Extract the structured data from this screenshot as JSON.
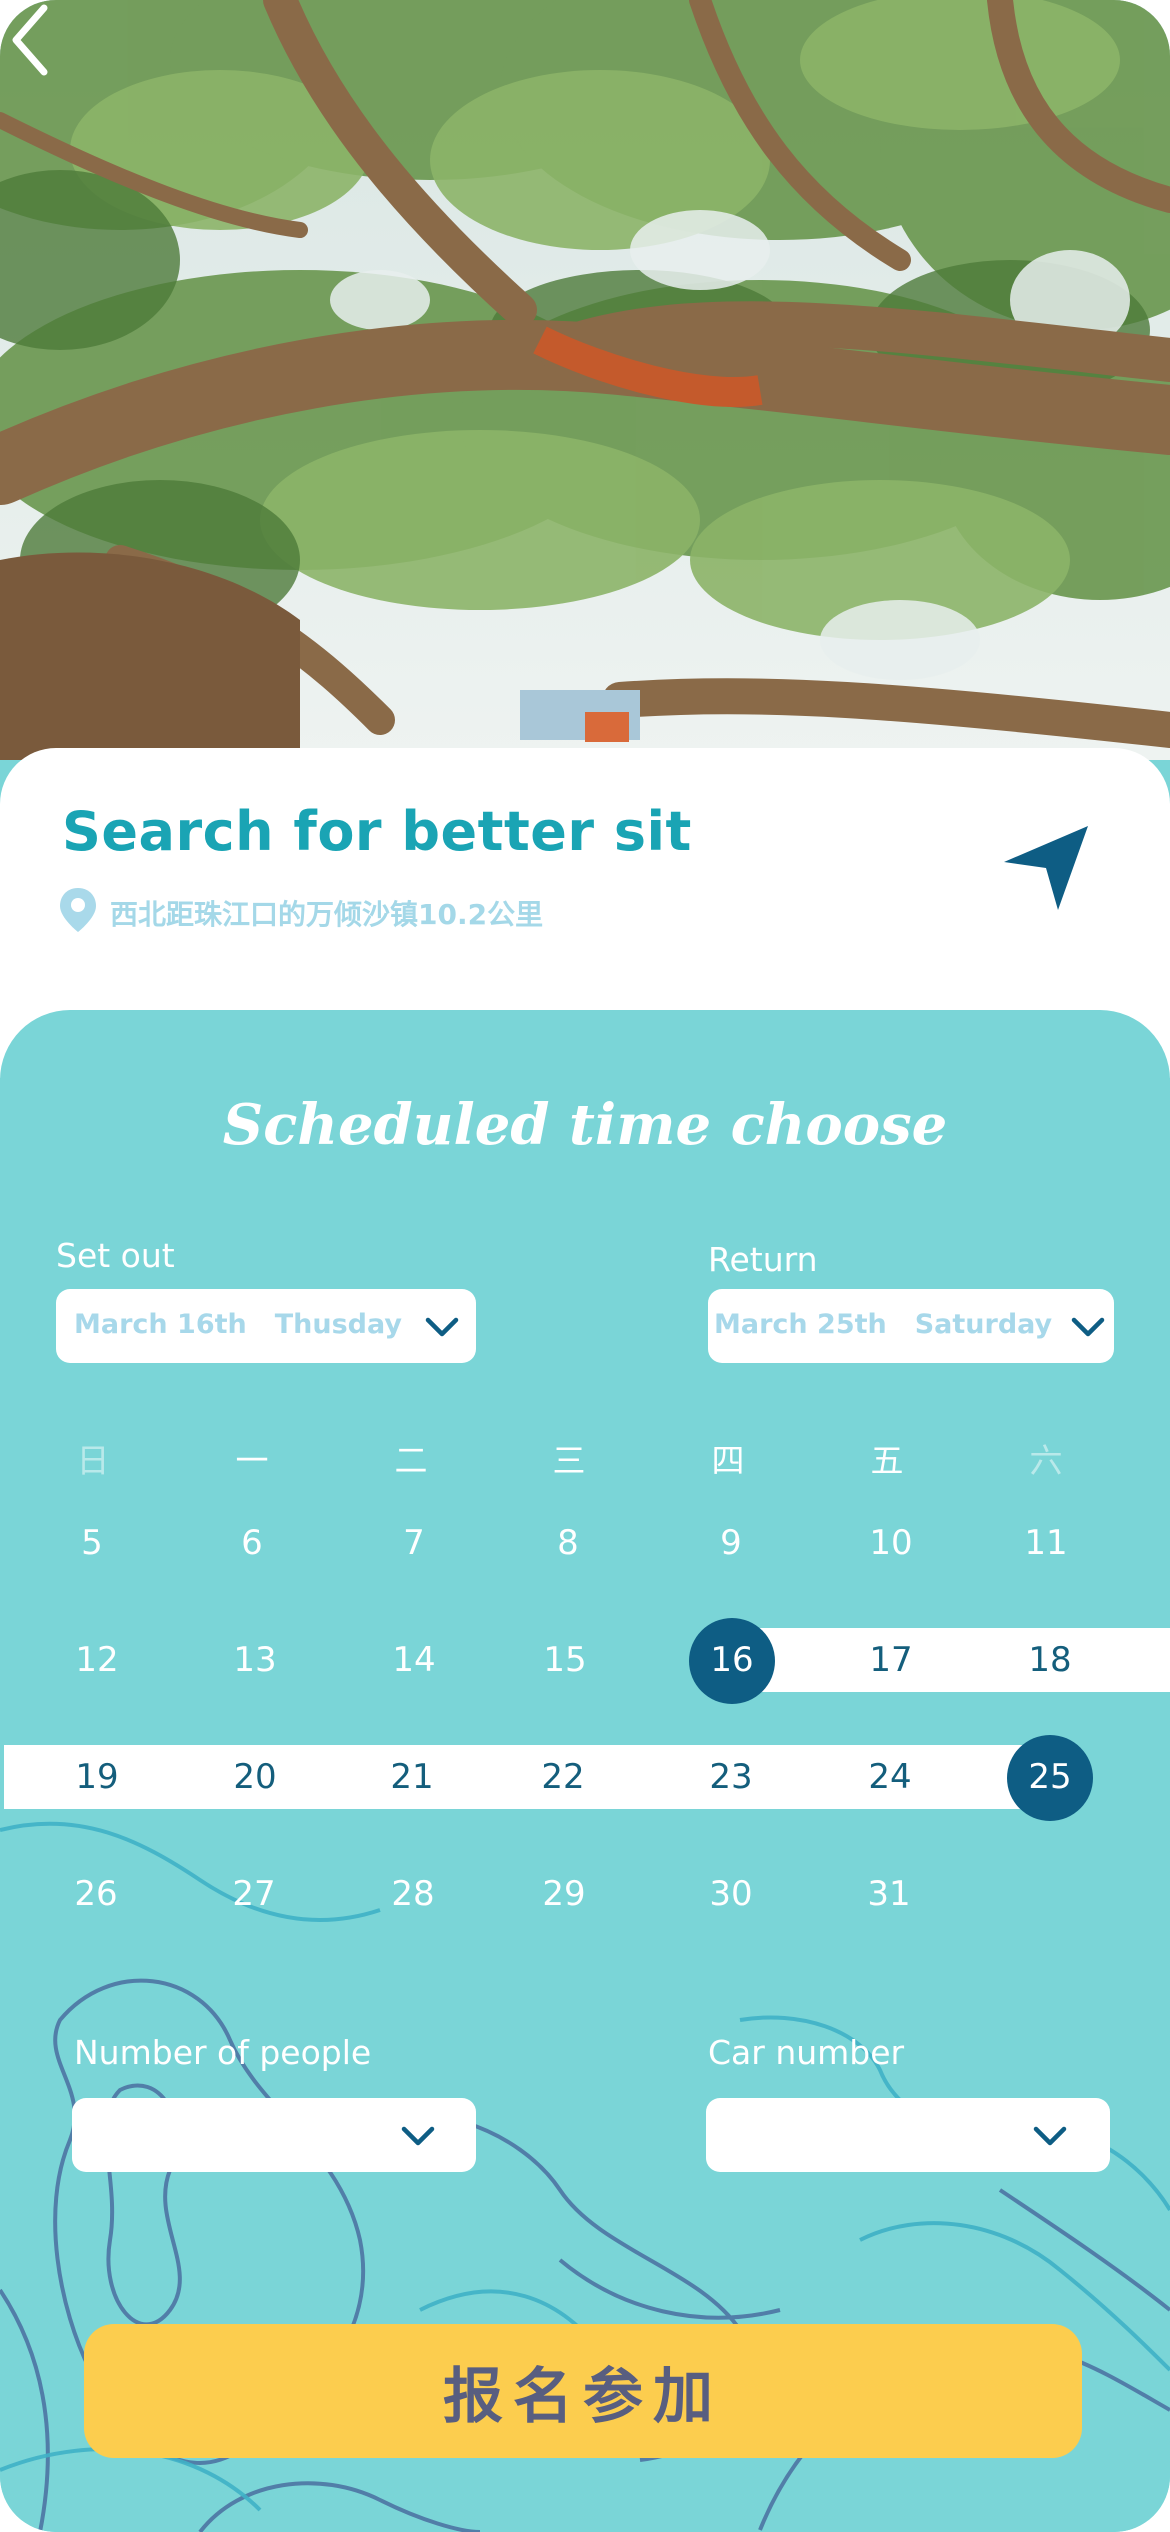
{
  "header": {
    "title": "Search for better sit",
    "location": "西北距珠江口的万倾沙镇10.2公里"
  },
  "schedule": {
    "title": "Scheduled time choose",
    "set_out": {
      "label": "Set out",
      "date": "March 16th",
      "weekday": "Thusday"
    },
    "return": {
      "label": "Return",
      "date": "March 25th",
      "weekday": "Saturday"
    }
  },
  "calendar": {
    "weekdays": [
      "日",
      "一",
      "二",
      "三",
      "四",
      "五",
      "六"
    ],
    "rows": [
      [
        "5",
        "6",
        "7",
        "8",
        "9",
        "10",
        "11"
      ],
      [
        "12",
        "13",
        "14",
        "15",
        "16",
        "17",
        "18"
      ],
      [
        "19",
        "20",
        "21",
        "22",
        "23",
        "24",
        "25"
      ],
      [
        "26",
        "27",
        "28",
        "29",
        "30",
        "31",
        ""
      ]
    ],
    "selected_start": "16",
    "selected_end": "25"
  },
  "form": {
    "people_label": "Number of people",
    "car_label": "Car number"
  },
  "signup_button": "报名参加",
  "colors": {
    "accent_teal": "#1aa4b4",
    "panel_teal": "#7ad5d7",
    "selected_navy": "#0e5d84",
    "button_yellow": "#fccd4e"
  },
  "icons": [
    "back-chevron-icon",
    "location-pin-icon",
    "navigation-arrow-icon",
    "chevron-down-icon"
  ]
}
